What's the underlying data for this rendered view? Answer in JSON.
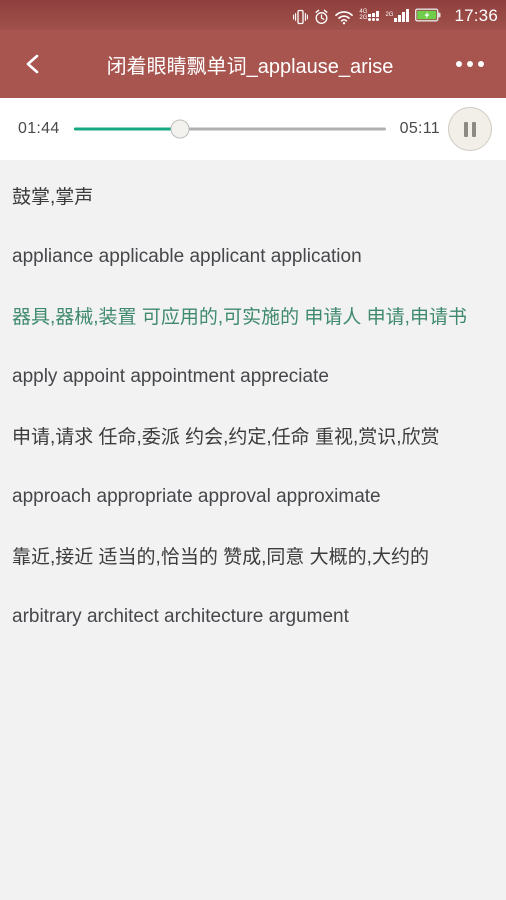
{
  "status_bar": {
    "time": "17:36",
    "network_primary_top": "4G",
    "network_primary_bottom": "2G",
    "network_secondary": "2G",
    "icons": [
      "vibrate-icon",
      "alarm-icon",
      "wifi-icon",
      "signal-4g2g-icon",
      "signal-2g-icon",
      "battery-charging-icon"
    ],
    "background_color": "#9a4a45"
  },
  "header": {
    "back_icon": "back-chevron-icon",
    "title": "闭着眼睛飘单词_applause_arise",
    "overflow_icon": "more-options-icon",
    "background_color": "#a8554f",
    "text_color": "#ffffff"
  },
  "player": {
    "current_time": "01:44",
    "total_time": "05:11",
    "progress_percent": 34,
    "fill_color": "#17a884",
    "track_color": "#b0b0b0",
    "button_state": "pause",
    "button_icon": "pause-icon"
  },
  "content": {
    "background_color": "#f2f2f2",
    "green_color": "#3f8a6e",
    "dark_color": "#3c3c3c",
    "blocks": [
      {
        "type": "translation",
        "style": "dark",
        "text": "鼓掌,掌声"
      },
      {
        "type": "english",
        "text": "appliance        applicable        applicant   application"
      },
      {
        "type": "translation",
        "style": "green",
        "text": "器具,器械,装置     可应用的,可实施的   申请人   申请,申请书"
      },
      {
        "type": "english",
        "text": "apply        appoint        appointment   appreciate"
      },
      {
        "type": "translation",
        "style": "dark",
        "text": "申请,请求      任命,委派      约会,约定,任命     重视,赏识,欣赏"
      },
      {
        "type": "english",
        "text": "approach       appropriate       approval   approximate"
      },
      {
        "type": "translation",
        "style": "dark",
        "text": "靠近,接近     适当的,恰当的     赞成,同意      大概的,大约的"
      },
      {
        "type": "english",
        "text": "arbitrary      architect       architecture   argument"
      }
    ]
  }
}
